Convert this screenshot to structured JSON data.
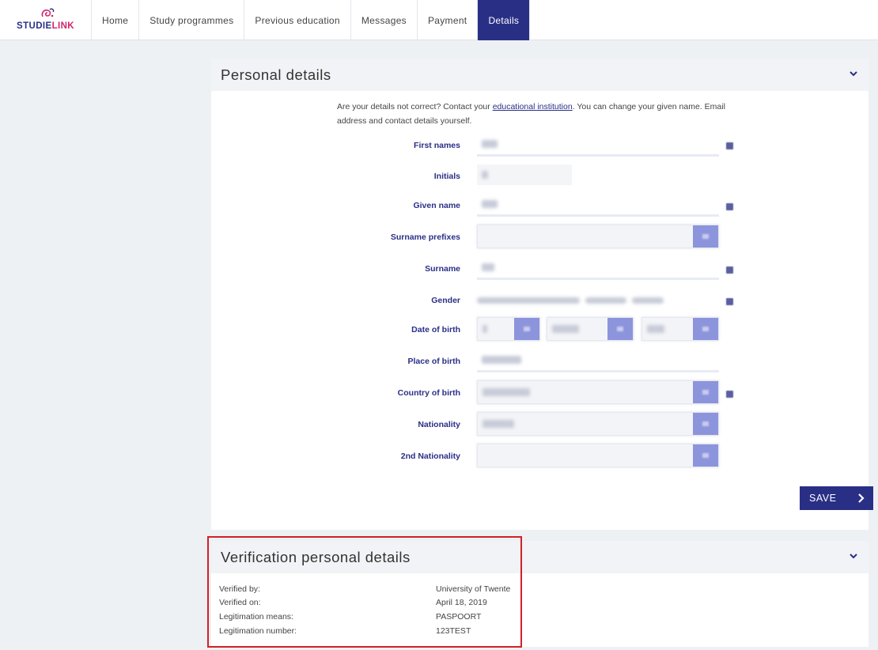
{
  "brand": {
    "name_a": "STUDIE",
    "name_b": "LINK",
    "accent": "#d2236c",
    "primary": "#2a2f86"
  },
  "nav": [
    {
      "label": "Home"
    },
    {
      "label": "Study programmes"
    },
    {
      "label": "Previous education"
    },
    {
      "label": "Messages"
    },
    {
      "label": "Payment"
    },
    {
      "label": "Details",
      "active": true
    }
  ],
  "personal": {
    "title": "Personal details",
    "info_pre": "Are your details not correct? Contact your ",
    "info_link": " educational institution",
    "info_post": ". You can change your given name. Email address and contact details yourself.",
    "fields": {
      "first_names": "First names",
      "initials": "Initials",
      "given_name": "Given name",
      "surname_prefixes": "Surname prefixes",
      "surname": "Surname",
      "gender": "Gender",
      "date_of_birth": "Date of birth",
      "place_of_birth": "Place of birth",
      "country_of_birth": "Country of birth",
      "nationality": "Nationality",
      "second_nationality": "2nd Nationality"
    },
    "save_label": "SAVE"
  },
  "verification": {
    "title": "Verification personal details",
    "rows": [
      {
        "label": "Verified by:",
        "value": "University of Twente"
      },
      {
        "label": "Verified on:",
        "value": "April 18, 2019"
      },
      {
        "label": "Legitimation means:",
        "value": "PASPOORT"
      },
      {
        "label": "Legitimation number:",
        "value": "123TEST"
      }
    ]
  }
}
